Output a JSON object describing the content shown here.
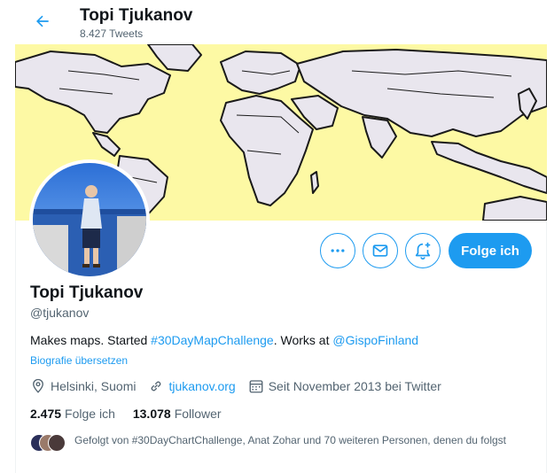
{
  "header": {
    "name": "Topi Tjukanov",
    "tweet_count": "8.427 Tweets",
    "back_icon": "arrow-left-icon"
  },
  "banner": {
    "description_icon": "world-map-banner",
    "bg_color": "#fdf9a4"
  },
  "profile": {
    "name": "Topi Tjukanov",
    "handle": "@tjukanov",
    "bio_prefix": "Makes maps. Started ",
    "bio_hashtag": "#30DayMapChallenge",
    "bio_middle": ". Works at ",
    "bio_mention": "@GispoFinland",
    "translate_label": "Biografie übersetzen",
    "location": "Helsinki, Suomi",
    "website": "tjukanov.org",
    "joined": "Seit November 2013 bei Twitter",
    "following_count": "2.475",
    "following_label": "Folge ich",
    "followers_count": "13.078",
    "followers_label": "Follower",
    "followed_by": "Gefolgt von #30DayChartChallenge, Anat Zohar und 70 weiteren Personen, denen du folgst"
  },
  "actions": {
    "more_icon": "more-dots-icon",
    "message_icon": "envelope-icon",
    "notify_icon": "bell-plus-icon",
    "follow_label": "Folge ich"
  },
  "colors": {
    "accent": "#1d9bf0",
    "text": "#0f1419",
    "muted": "#536471"
  }
}
